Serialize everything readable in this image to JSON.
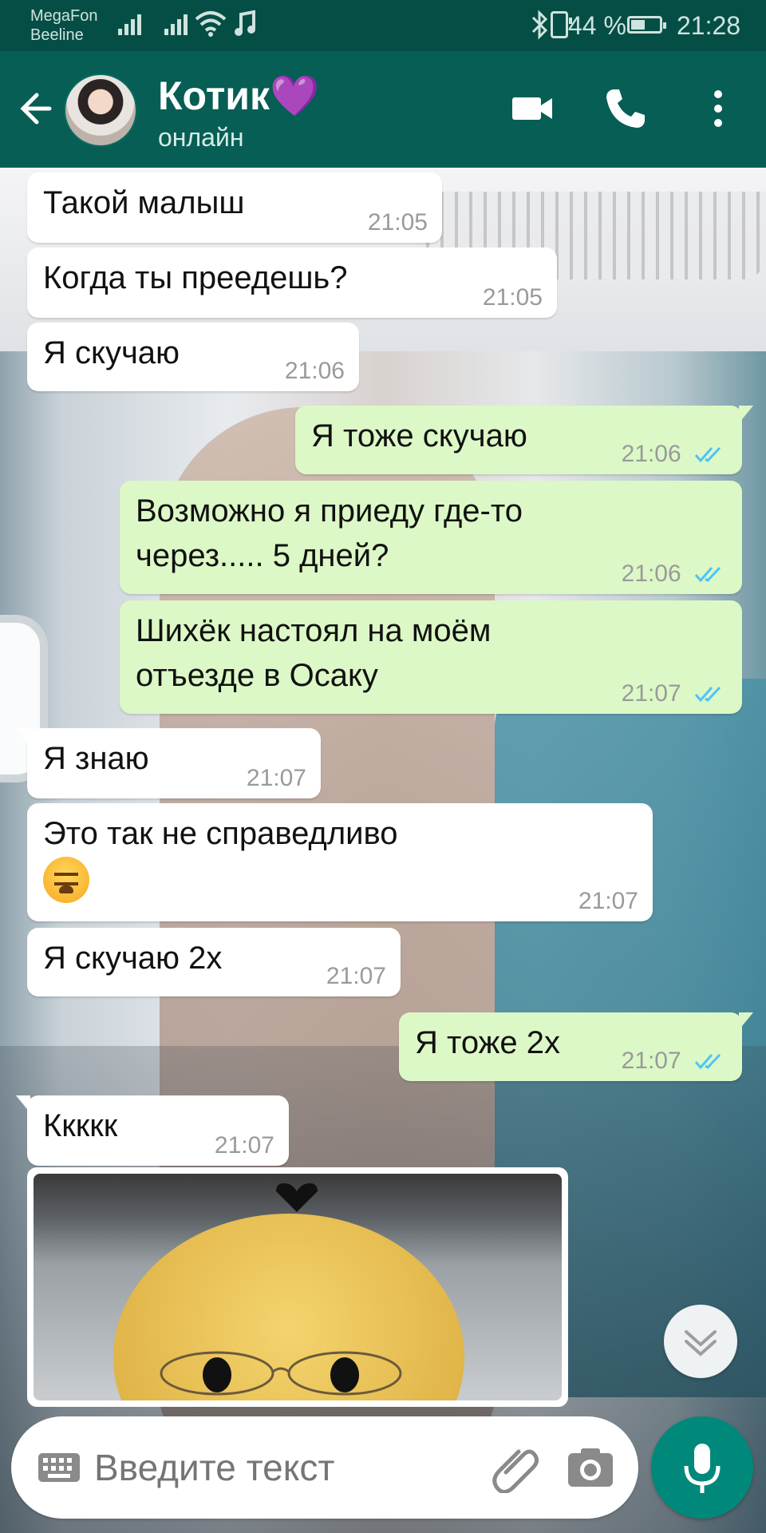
{
  "status_bar": {
    "carrier1": "MegaFon",
    "carrier2": "Beeline",
    "battery": "44 %",
    "time": "21:28"
  },
  "header": {
    "name": "Котик💜",
    "status": "онлайн"
  },
  "messages": [
    {
      "dir": "in",
      "text": "Такой малыш",
      "time": "21:05"
    },
    {
      "dir": "in",
      "text": "Когда ты преедешь?",
      "time": "21:05"
    },
    {
      "dir": "in",
      "text": "Я скучаю",
      "time": "21:06"
    },
    {
      "dir": "out",
      "text": "Я тоже скучаю",
      "time": "21:06"
    },
    {
      "dir": "out",
      "text": "Возможно я приеду где-то через..... 5 дней?",
      "time": "21:06"
    },
    {
      "dir": "out",
      "text": "Шихёк настоял на моём отъезде в Осаку",
      "time": "21:07"
    },
    {
      "dir": "in",
      "text": "Я знаю",
      "time": "21:07"
    },
    {
      "dir": "in",
      "text": "Это так не справедливо",
      "time": "21:07"
    },
    {
      "dir": "in",
      "text": "Я скучаю 2х",
      "time": "21:07"
    },
    {
      "dir": "out",
      "text": "Я тоже 2х",
      "time": "21:07"
    },
    {
      "dir": "in",
      "text": "Ккккк",
      "time": "21:07"
    }
  ],
  "input": {
    "placeholder": "Введите текст"
  },
  "colors": {
    "header": "#075e54",
    "status_bar": "#054e45",
    "outgoing_bubble": "#dcf8c6",
    "incoming_bubble": "#ffffff",
    "read_check": "#4fc3f7",
    "mic_button": "#00897b"
  },
  "icons": [
    "back-arrow-icon",
    "video-call-icon",
    "phone-icon",
    "more-vert-icon",
    "double-check-icon",
    "keyboard-icon",
    "attach-icon",
    "camera-icon",
    "mic-icon",
    "chevron-down-icon",
    "tired-face-emoji"
  ]
}
